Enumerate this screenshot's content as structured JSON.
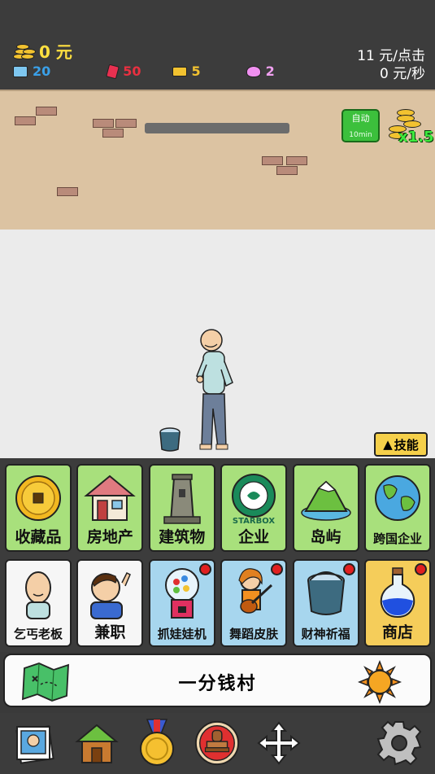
{
  "stats": {
    "money": "0 元",
    "tickets": "20",
    "cards": "50",
    "cakes": "5",
    "gems": "2",
    "per_click": "11 元/点击",
    "per_second": "0 元/秒"
  },
  "scene": {
    "auto_label": "自动",
    "auto_duration": "10min",
    "multiplier": "x1.5",
    "skill_label": "技能"
  },
  "grid": [
    {
      "label": "收藏品",
      "style": "green",
      "icon": "gold-coin-icon"
    },
    {
      "label": "房地产",
      "style": "green",
      "icon": "house-icon"
    },
    {
      "label": "建筑物",
      "style": "green",
      "icon": "tower-icon"
    },
    {
      "label": "企业",
      "style": "green",
      "icon": "starbox-logo-icon",
      "logo_text": "STARBOX"
    },
    {
      "label": "岛屿",
      "style": "green",
      "icon": "island-icon"
    },
    {
      "label": "跨国企业",
      "style": "green",
      "icon": "globe-icon"
    },
    {
      "label": "乞丐老板",
      "style": "white",
      "icon": "beggar-boss-icon"
    },
    {
      "label": "兼职",
      "style": "white",
      "icon": "part-time-worker-icon"
    },
    {
      "label": "抓娃娃机",
      "style": "blue",
      "icon": "gumball-machine-icon",
      "badge": true
    },
    {
      "label": "舞蹈皮肤",
      "style": "blue",
      "icon": "guitar-girl-icon",
      "badge": true
    },
    {
      "label": "财神祈福",
      "style": "blue",
      "icon": "bucket-icon",
      "badge": true
    },
    {
      "label": "商店",
      "style": "yellow",
      "icon": "potion-icon",
      "badge": true
    }
  ],
  "village": {
    "name": "一分钱村"
  },
  "nav": [
    {
      "icon": "photo-album-icon"
    },
    {
      "icon": "home-icon"
    },
    {
      "icon": "medal-icon"
    },
    {
      "icon": "stamp-icon"
    },
    {
      "icon": "move-arrows-icon"
    },
    {
      "icon": "settings-gear-icon"
    }
  ],
  "colors": {
    "money": "#ffe040",
    "tickets": "#3aa0e8",
    "cards": "#e83040",
    "cakes": "#f2c230",
    "gems": "#e080e0",
    "tile_green": "#a8e07c",
    "tile_blue": "#a7d6ee",
    "tile_yellow": "#f5cd5a"
  }
}
